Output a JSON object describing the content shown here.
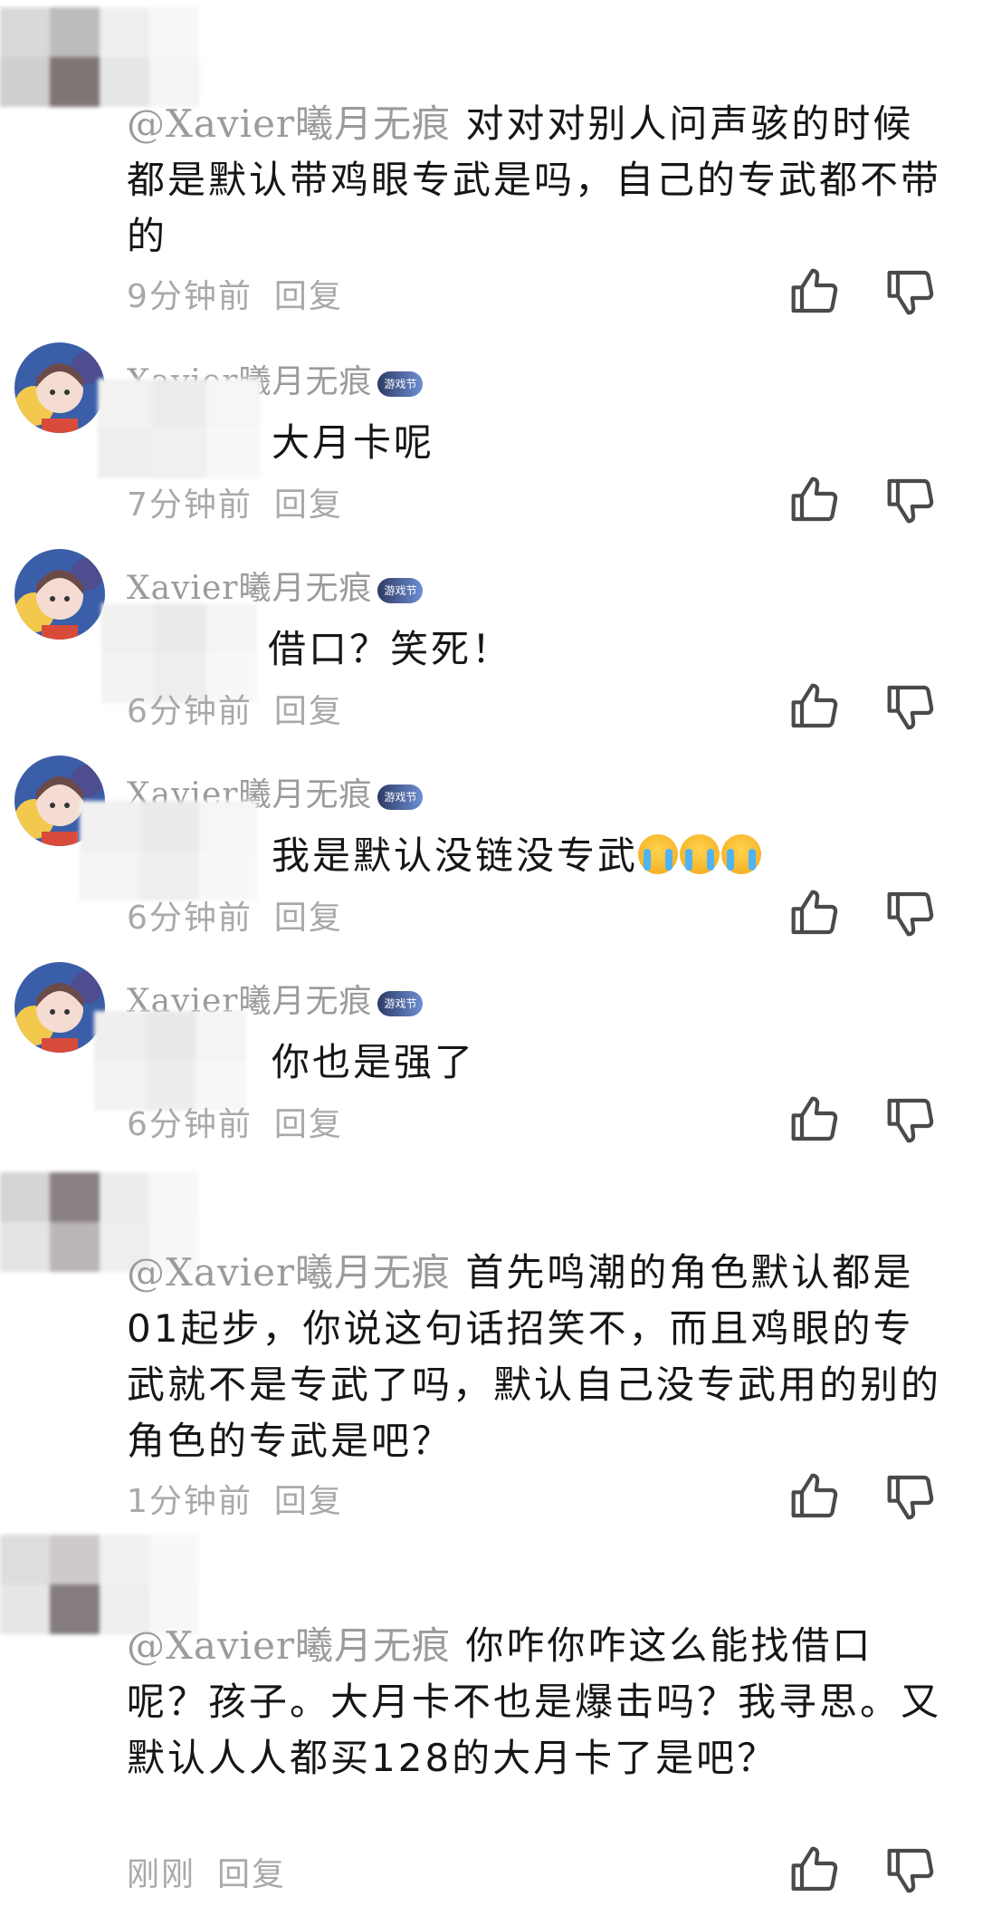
{
  "comments": [
    {
      "mention": "@Xavier曦月无痕",
      "text": " 对对对别人问声骇的时候都是默认带鸡眼专武是吗，自己的专武都不带的",
      "time": "9分钟前",
      "reply": "回复"
    },
    {
      "name": "Xavier曦月无痕",
      "badge": "游戏节",
      "text": "大月卡呢",
      "time": "7分钟前",
      "reply": "回复"
    },
    {
      "name": "Xavier曦月无痕",
      "badge": "游戏节",
      "text": "借口？笑死！",
      "time": "6分钟前",
      "reply": "回复"
    },
    {
      "name": "Xavier曦月无痕",
      "badge": "游戏节",
      "text": "我是默认没链没专武",
      "emoji_count": 3,
      "time": "6分钟前",
      "reply": "回复"
    },
    {
      "name": "Xavier曦月无痕",
      "badge": "游戏节",
      "text": "你也是强了",
      "time": "6分钟前",
      "reply": "回复"
    },
    {
      "mention": "@Xavier曦月无痕",
      "text": " 首先鸣潮的角色默认都是01起步，你说这句话招笑不，而且鸡眼的专武就不是专武了吗，默认自己没专武用的别的角色的专武是吧？",
      "time": "1分钟前",
      "reply": "回复"
    },
    {
      "mention": "@Xavier曦月无痕",
      "text": " 你咋你咋这么能找借口呢？孩子。大月卡不也是爆击吗？我寻思。又默认人人都买128的大月卡了是吧？",
      "time": "刚刚",
      "reply": "回复"
    }
  ],
  "icons": {
    "like": "thumbs-up-icon",
    "dislike": "thumbs-down-icon"
  },
  "colors": {
    "text": "#161616",
    "muted": "#9b9b9b",
    "icon": "#4a4a4a"
  }
}
